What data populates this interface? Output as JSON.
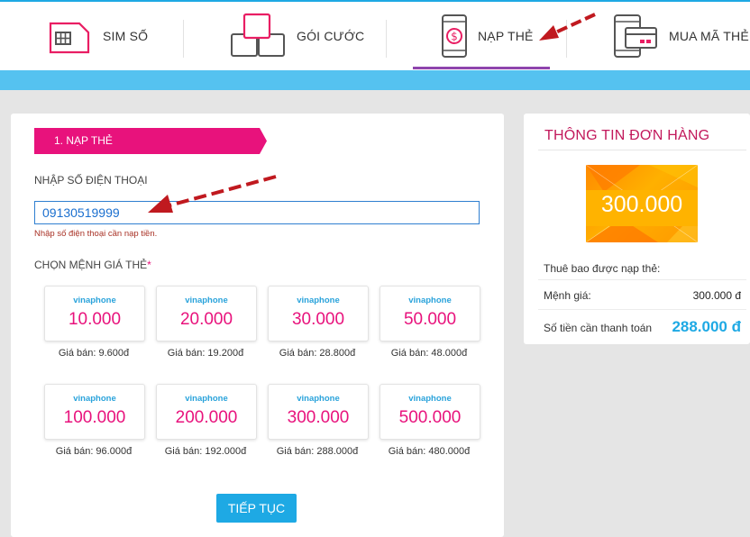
{
  "nav": {
    "items": [
      {
        "label": "SIM SỐ",
        "icon": "sim-card-icon"
      },
      {
        "label": "GÓI CƯỚC",
        "icon": "package-icon"
      },
      {
        "label": "NẠP THẺ",
        "icon": "phone-topup-icon"
      },
      {
        "label": "MUA MÃ THẺ",
        "icon": "buy-card-code-icon"
      }
    ],
    "active": "NẠP THẺ"
  },
  "form": {
    "step_label": "1. NẠP THẺ",
    "phone_label": "NHẬP SỐ ĐIỆN THOẠI",
    "phone_value": "09130519999",
    "phone_hint": "Nhập số điện thoại cần nạp tiền.",
    "denomination_label": "CHỌN MỆNH GIÁ THẺ",
    "required_mark": "*",
    "continue_label": "TIẾP TỤC"
  },
  "cards": [
    {
      "brand": "vinaphone",
      "value": "10.000",
      "price": "Giá bán: 9.600đ"
    },
    {
      "brand": "vinaphone",
      "value": "20.000",
      "price": "Giá bán: 19.200đ"
    },
    {
      "brand": "vinaphone",
      "value": "30.000",
      "price": "Giá bán: 28.800đ"
    },
    {
      "brand": "vinaphone",
      "value": "50.000",
      "price": "Giá bán: 48.000đ"
    },
    {
      "brand": "vinaphone",
      "value": "100.000",
      "price": "Giá bán: 96.000đ"
    },
    {
      "brand": "vinaphone",
      "value": "200.000",
      "price": "Giá bán: 192.000đ"
    },
    {
      "brand": "vinaphone",
      "value": "300.000",
      "price": "Giá bán: 288.000đ"
    },
    {
      "brand": "vinaphone",
      "value": "500.000",
      "price": "Giá bán: 480.000đ"
    }
  ],
  "order": {
    "title": "THÔNG TIN ĐƠN HÀNG",
    "card_amount": "300.000",
    "subscriber_label": "Thuê bao được nạp thẻ:",
    "face_value_label": "Mệnh giá:",
    "face_value": "300.000 đ",
    "total_label": "Số tiền cần thanh toán",
    "total": "288.000 đ"
  },
  "colors": {
    "accent_pink": "#e8127c",
    "accent_blue": "#1ea9e4",
    "annotation_arrow": "#c0191f"
  }
}
